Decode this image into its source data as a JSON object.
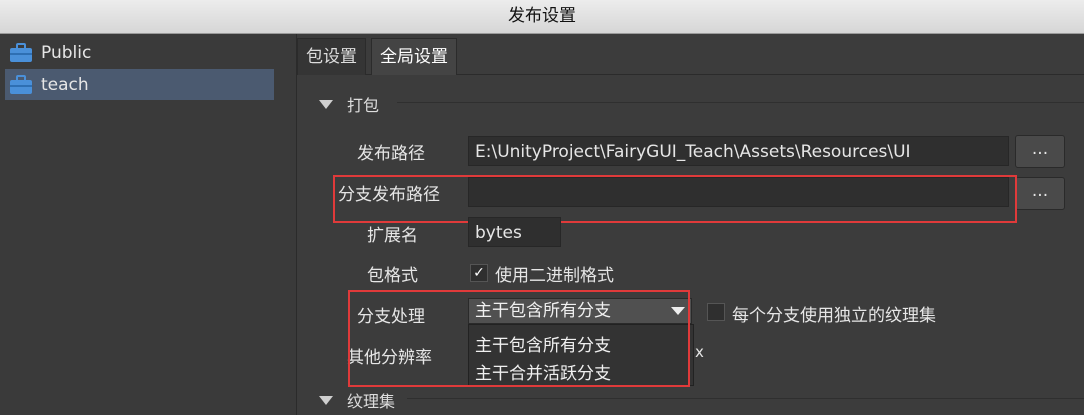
{
  "window": {
    "title": "发布设置"
  },
  "sidebar": {
    "items": [
      {
        "label": "Public",
        "icon": "briefcase-icon",
        "selected": false
      },
      {
        "label": "teach",
        "icon": "briefcase-icon",
        "selected": true
      }
    ]
  },
  "tabs": [
    {
      "label": "包设置",
      "active": false
    },
    {
      "label": "全局设置",
      "active": true
    }
  ],
  "sections": {
    "pack": {
      "title": "打包"
    },
    "atlas": {
      "title": "纹理集"
    }
  },
  "form": {
    "publish_path": {
      "label": "发布路径",
      "value": "E:\\UnityProject\\FairyGUI_Teach\\Assets\\Resources\\UI",
      "browse": "..."
    },
    "branch_path": {
      "label": "分支发布路径",
      "value": "",
      "browse": "..."
    },
    "extension": {
      "label": "扩展名",
      "value": "bytes"
    },
    "package_format": {
      "label": "包格式",
      "checkbox_label": "使用二进制格式",
      "checked": true
    },
    "branch_processing": {
      "label": "分支处理",
      "selected": "主干包含所有分支",
      "options": [
        "主干包含所有分支",
        "主干合并活跃分支"
      ],
      "checkbox_label": "每个分支使用独立的纹理集",
      "checked": false
    },
    "other_resolution": {
      "label": "其他分辨率",
      "suffix": "x"
    }
  },
  "colors": {
    "highlight_box": "#e03a3a",
    "selected_item": "#4b5a70"
  }
}
